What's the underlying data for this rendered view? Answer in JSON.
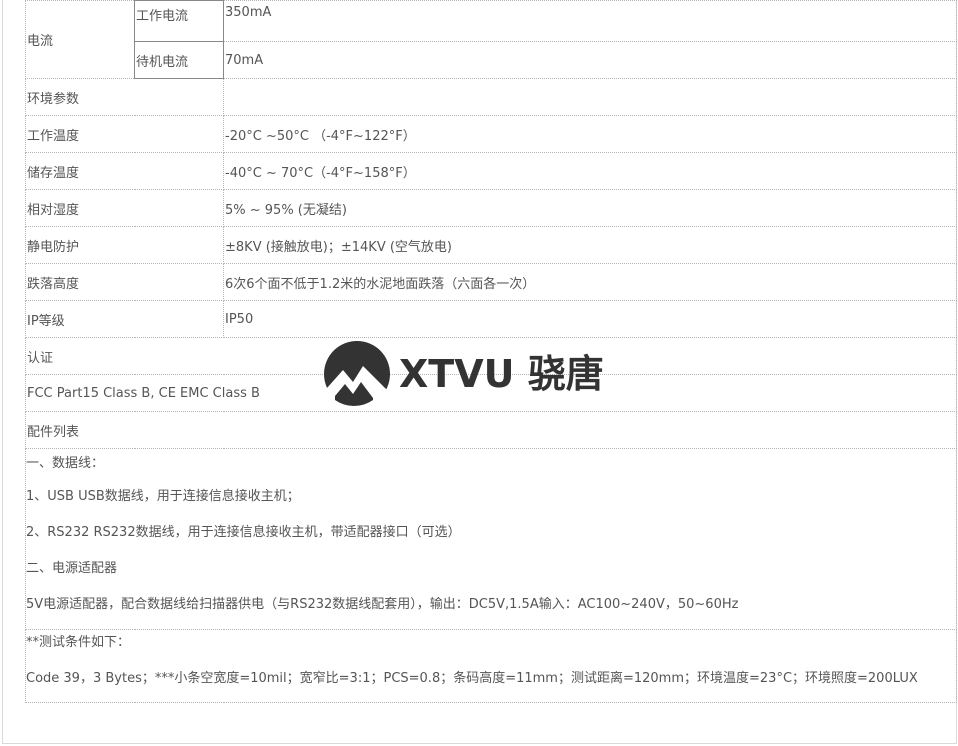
{
  "spec_table": {
    "current": {
      "label": "电流",
      "working_label": "工作电流",
      "working_value": "350mA",
      "standby_label": "待机电流",
      "standby_value": "70mA"
    },
    "rows": [
      {
        "label": "环境参数",
        "value": ""
      },
      {
        "label": "工作温度",
        "value": "-20°C ~50°C （-4°F~122°F）"
      },
      {
        "label": "储存温度",
        "value": "-40°C ~ 70°C（-4°F~158°F）"
      },
      {
        "label": "相对湿度",
        "value": "5% ~ 95% (无凝结)"
      },
      {
        "label": "静电防护",
        "value": "±8KV (接触放电)；±14KV (空气放电)"
      },
      {
        "label": "跌落高度",
        "value": "6次6个面不低于1.2米的水泥地面跌落（六面各一次）"
      },
      {
        "label": "IP等级",
        "value": "IP50"
      }
    ],
    "certification_header": "认证",
    "certification_value": "FCC Part15 Class B, CE EMC Class B",
    "accessories_header": "配件列表",
    "accessories_lines": [
      "一、数据线：",
      "1、USB  USB数据线，用于连接信息接收主机；",
      "2、RS232  RS232数据线，用于连接信息接收主机，带适配器接口（可选）",
      "二、电源适配器",
      "5V电源适配器，配合数据线给扫描器供电（与RS232数据线配套用），输出：DC5V,1.5A输入：AC100~240V，50~60Hz"
    ],
    "test_lines": [
      "**测试条件如下：",
      "Code 39，3 Bytes；***小条空宽度=10mil；宽窄比=3:1；PCS=0.8；条码高度=11mm；测试距离=120mm；环境温度=23°C；环境照度=200LUX"
    ]
  },
  "watermark": {
    "text": "XTVU 骁唐",
    "color": "#333333"
  }
}
